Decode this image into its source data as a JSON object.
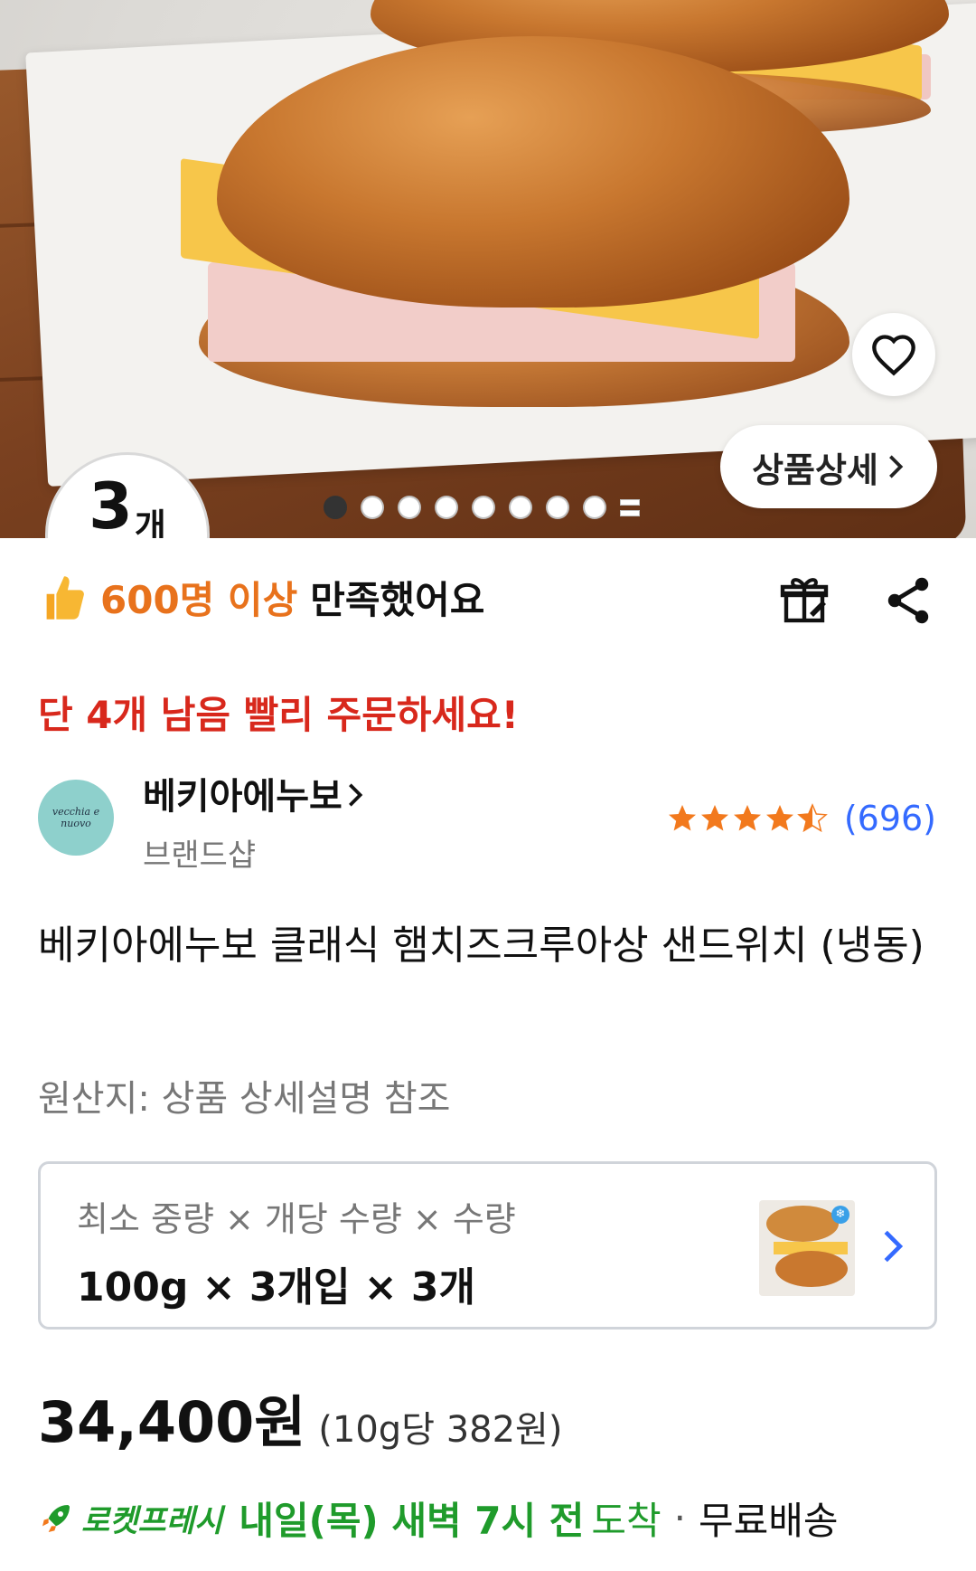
{
  "hero": {
    "quantity_number": "3",
    "quantity_unit": "개",
    "detail_button_label": "상품상세",
    "carousel": {
      "total": 9,
      "active_index": 0
    }
  },
  "satisfaction": {
    "highlight": "600명 이상",
    "rest": "만족했어요"
  },
  "stock_notice": "단 4개 남음 빨리 주문하세요!",
  "brand": {
    "name": "베키아에누보",
    "subtitle": "브랜드샵",
    "logo_text": "vecchia e nuovo",
    "rating": 4.5,
    "review_count": "(696)"
  },
  "product": {
    "title": "베키아에누보 클래식 햄치즈크루아상 샌드위치 (냉동)",
    "origin": "원산지: 상품 상세설명 참조"
  },
  "option": {
    "label": "최소 중량 × 개당 수량 × 수량",
    "value": "100g × 3개입 × 3개"
  },
  "price": {
    "main": "34,400원",
    "unit_price": "(10g당 382원)"
  },
  "delivery": {
    "badge": "로켓프레시",
    "when_bold": "내일(목) 새벽 7시 전",
    "arrive": "도착",
    "separator": "·",
    "shipping": "무료배송"
  },
  "colors": {
    "accent_orange": "#e8721c",
    "stock_red": "#d8281c",
    "link_blue": "#346aff",
    "rocket_green": "#1f9b2b",
    "star_orange": "#f2791d"
  }
}
